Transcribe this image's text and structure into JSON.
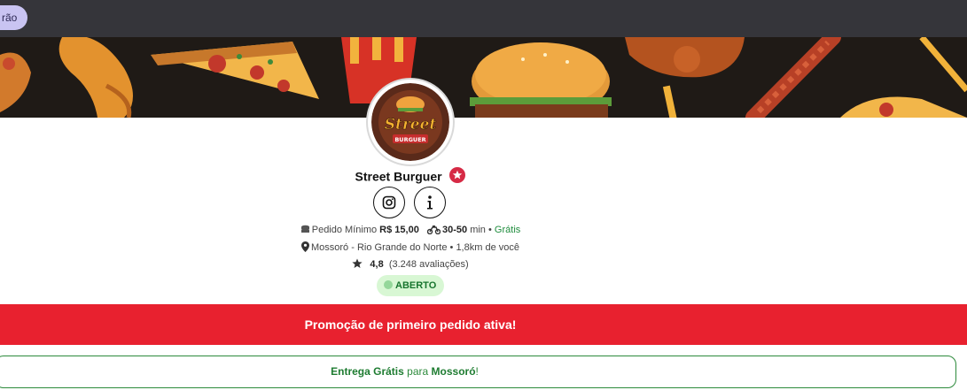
{
  "topbar": {
    "pill_label": "rão"
  },
  "store": {
    "name": "Street Burguer",
    "logo_text_main": "Street",
    "logo_text_sub": "BURGUER"
  },
  "info": {
    "min_order_label": "Pedido Mínimo",
    "min_order_value": "R$ 15,00",
    "delivery_time_value": "30-50",
    "delivery_time_unit": "min",
    "separator": "•",
    "delivery_fee": "Grátis",
    "location": "Mossoró - Rio Grande do Norte",
    "distance": "1,8km de você",
    "rating": "4,8",
    "reviews": "(3.248 avaliações)"
  },
  "status": {
    "label": "ABERTO"
  },
  "promo": {
    "text": "Promoção de primeiro pedido ativa!"
  },
  "delivery_notice": {
    "part1": "Entrega Grátis",
    "part2": "para",
    "part3": "Mossoró",
    "part4": "!"
  },
  "colors": {
    "topbar": "#35353a",
    "accent_red": "#e8212f",
    "open_green": "#1f8c3d",
    "badge_red": "#d62a45"
  }
}
